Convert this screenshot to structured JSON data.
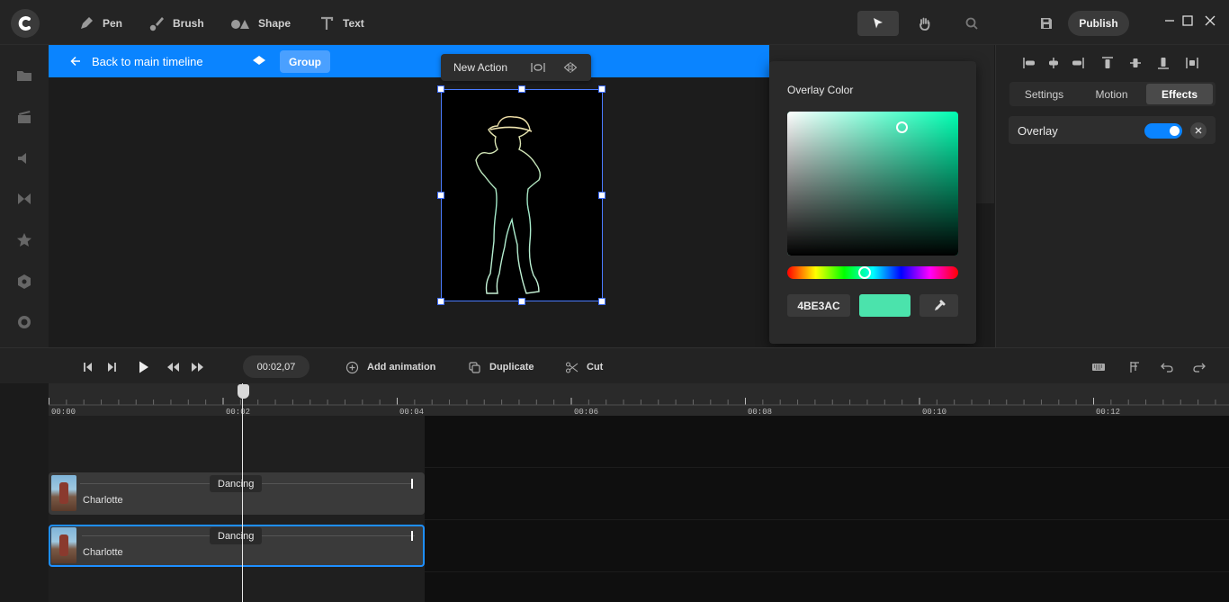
{
  "toolbar": {
    "tools": [
      {
        "label": "Pen",
        "icon": "pen-icon"
      },
      {
        "label": "Brush",
        "icon": "brush-icon"
      },
      {
        "label": "Shape",
        "icon": "shape-icon"
      },
      {
        "label": "Text",
        "icon": "text-icon"
      }
    ],
    "publish_label": "Publish"
  },
  "breadcrumb": {
    "back_label": "Back to main timeline",
    "group_label": "Group"
  },
  "action_bar": {
    "label": "New Action"
  },
  "color_picker": {
    "title": "Overlay Color",
    "hex": "4BE3AC",
    "color": "#4be3ac",
    "hue_fraction": 0.45
  },
  "properties": {
    "tabs": [
      {
        "label": "Settings",
        "active": false
      },
      {
        "label": "Motion",
        "active": false
      },
      {
        "label": "Effects",
        "active": true
      }
    ],
    "overlay_label": "Overlay",
    "overlay_on": true
  },
  "timeline_toolbar": {
    "timecode": "00:02,07",
    "add_animation": "Add animation",
    "duplicate": "Duplicate",
    "cut": "Cut"
  },
  "ruler": {
    "labels": [
      "00:00",
      "00:02",
      "00:04",
      "00:06",
      "00:08",
      "00:10",
      "00:12"
    ]
  },
  "tracks": [
    {
      "name": "Charlotte",
      "action": "Dancing",
      "selected": false
    },
    {
      "name": "Charlotte",
      "action": "Dancing",
      "selected": true
    }
  ],
  "colors": {
    "accent": "#0a84ff",
    "overlay": "#4be3ac"
  }
}
